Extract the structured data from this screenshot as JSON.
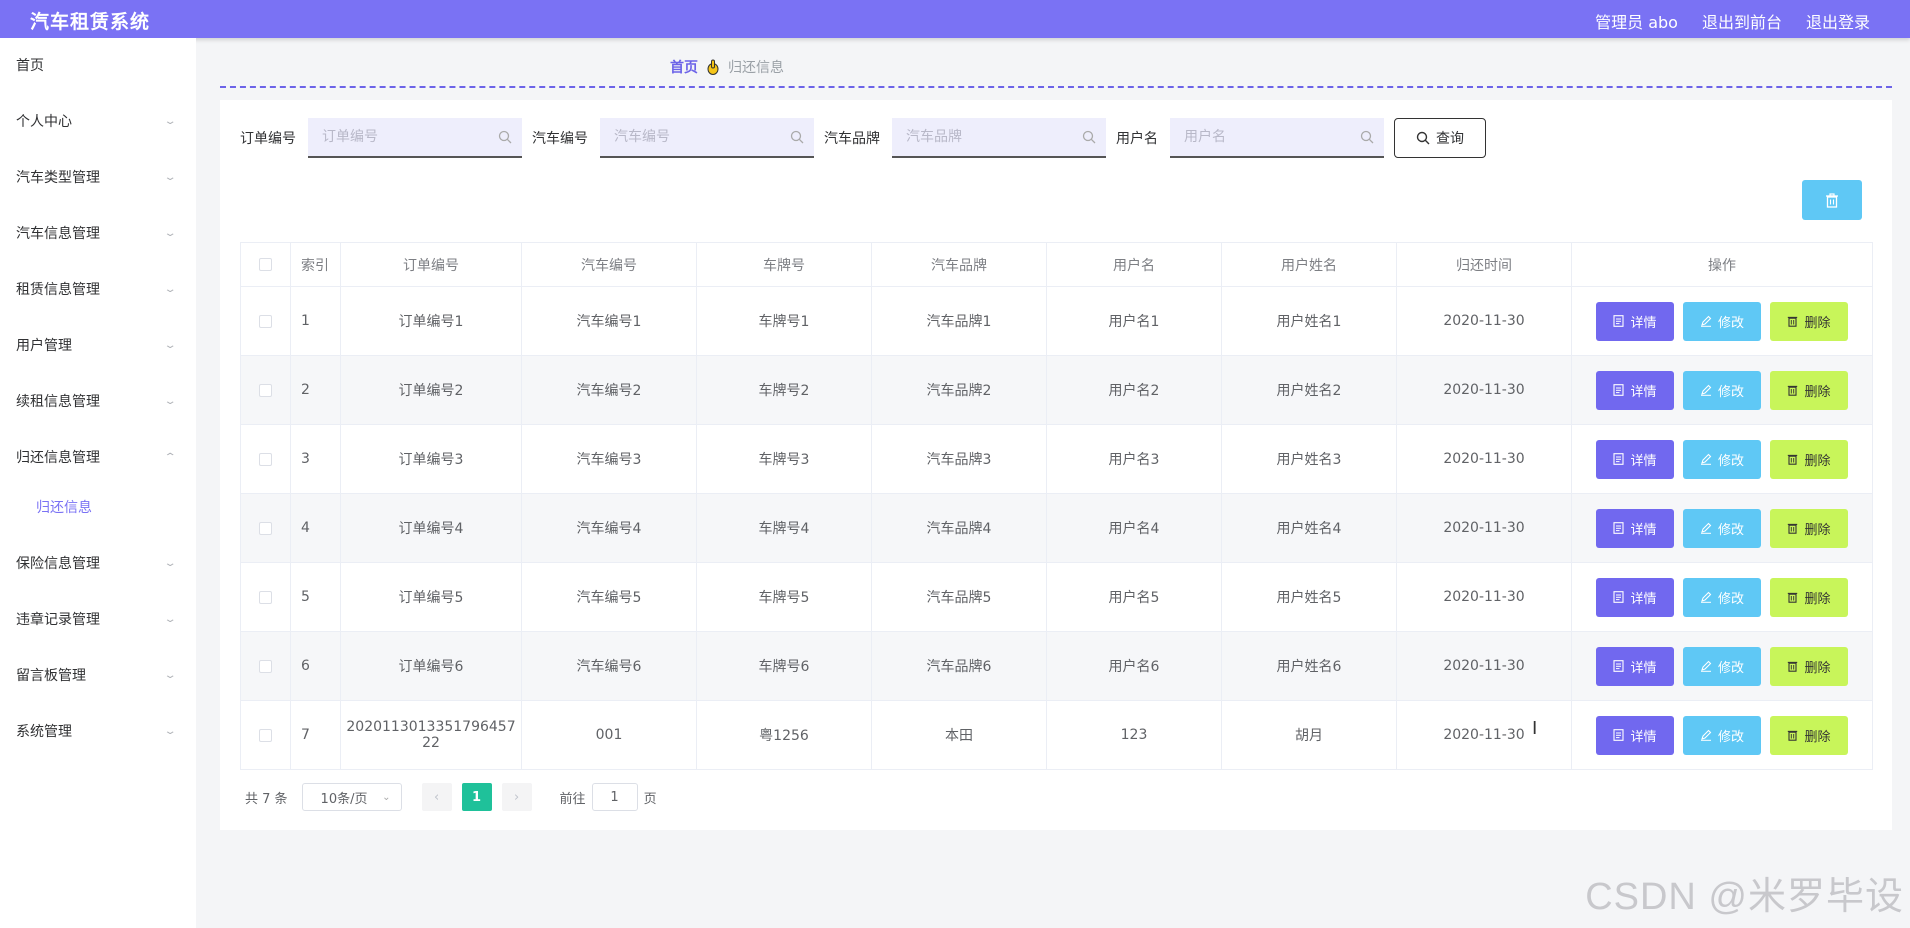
{
  "header": {
    "app_title": "汽车租赁系统",
    "user": "管理员 abo",
    "to_front": "退出到前台",
    "logout": "退出登录"
  },
  "sidebar": {
    "items": [
      {
        "label": "首页",
        "has_arrow": false
      },
      {
        "label": "个人中心",
        "has_arrow": true
      },
      {
        "label": "汽车类型管理",
        "has_arrow": true
      },
      {
        "label": "汽车信息管理",
        "has_arrow": true
      },
      {
        "label": "租赁信息管理",
        "has_arrow": true
      },
      {
        "label": "用户管理",
        "has_arrow": true
      },
      {
        "label": "续租信息管理",
        "has_arrow": true
      },
      {
        "label": "归还信息管理",
        "has_arrow": true,
        "expanded": true
      },
      {
        "label": "保险信息管理",
        "has_arrow": true
      },
      {
        "label": "违章记录管理",
        "has_arrow": true
      },
      {
        "label": "留言板管理",
        "has_arrow": true
      },
      {
        "label": "系统管理",
        "has_arrow": true
      }
    ],
    "sub_item": "归还信息"
  },
  "breadcrumb": {
    "home": "首页",
    "current": "归还信息"
  },
  "search": {
    "fields": [
      {
        "label": "订单编号",
        "placeholder": "订单编号"
      },
      {
        "label": "汽车编号",
        "placeholder": "汽车编号"
      },
      {
        "label": "汽车品牌",
        "placeholder": "汽车品牌"
      },
      {
        "label": "用户名",
        "placeholder": "用户名"
      }
    ],
    "query_label": "查询"
  },
  "table": {
    "headers": [
      "索引",
      "订单编号",
      "汽车编号",
      "车牌号",
      "汽车品牌",
      "用户名",
      "用户姓名",
      "归还时间",
      "操作"
    ],
    "rows": [
      [
        "1",
        "订单编号1",
        "汽车编号1",
        "车牌号1",
        "汽车品牌1",
        "用户名1",
        "用户姓名1",
        "2020-11-30"
      ],
      [
        "2",
        "订单编号2",
        "汽车编号2",
        "车牌号2",
        "汽车品牌2",
        "用户名2",
        "用户姓名2",
        "2020-11-30"
      ],
      [
        "3",
        "订单编号3",
        "汽车编号3",
        "车牌号3",
        "汽车品牌3",
        "用户名3",
        "用户姓名3",
        "2020-11-30"
      ],
      [
        "4",
        "订单编号4",
        "汽车编号4",
        "车牌号4",
        "汽车品牌4",
        "用户名4",
        "用户姓名4",
        "2020-11-30"
      ],
      [
        "5",
        "订单编号5",
        "汽车编号5",
        "车牌号5",
        "汽车品牌5",
        "用户名5",
        "用户姓名5",
        "2020-11-30"
      ],
      [
        "6",
        "订单编号6",
        "汽车编号6",
        "车牌号6",
        "汽车品牌6",
        "用户名6",
        "用户姓名6",
        "2020-11-30"
      ],
      [
        "7",
        "2020113013351796457 22",
        "001",
        "粤1256",
        "本田",
        "123",
        "胡月",
        "2020-11-30"
      ]
    ],
    "actions": {
      "detail": "详情",
      "edit": "修改",
      "delete": "删除"
    }
  },
  "pagination": {
    "total": "共 7 条",
    "page_size": "10条/页",
    "current_page": "1",
    "goto_label": "前往",
    "goto_value": "1",
    "page_suffix": "页"
  },
  "watermark": "CSDN @米罗毕设",
  "colors": {
    "header_bg": "#7a72f4",
    "accent": "#6c63e8",
    "detail_btn": "#7168ef",
    "edit_btn": "#5fc8f5",
    "delete_btn": "#c8f55a",
    "pager_active": "#1fc19a"
  },
  "icons": {
    "breadcrumb_separator": "hand-icon",
    "search": "search-icon",
    "delete": "trash-icon",
    "edit": "pencil-icon",
    "detail": "document-icon"
  }
}
